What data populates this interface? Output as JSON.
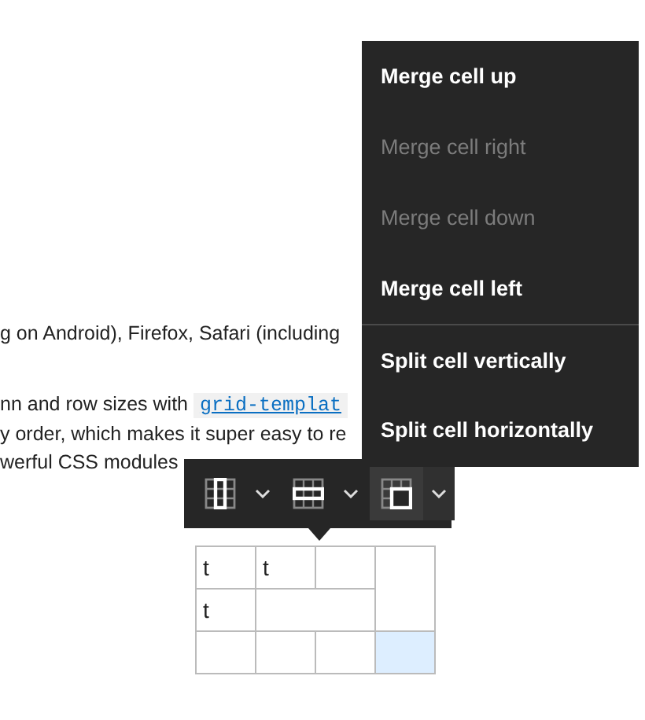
{
  "article": {
    "line_1": "g on Android), Firefox, Safari (including",
    "line_2_text": "nn and row sizes with ",
    "line_2_code": "grid-templat",
    "line_3": "y order, which makes it super easy to re",
    "line_4": "werful CSS modules"
  },
  "toolbar": {
    "buttons": [
      {
        "kind": "column",
        "selected": false
      },
      {
        "kind": "row",
        "selected": false
      },
      {
        "kind": "cell",
        "selected": true
      }
    ]
  },
  "menu": {
    "merge_items": [
      {
        "label": "Merge cell up",
        "disabled": false
      },
      {
        "label": "Merge cell right",
        "disabled": true
      },
      {
        "label": "Merge cell down",
        "disabled": true
      },
      {
        "label": "Merge cell left",
        "disabled": false
      }
    ],
    "split_items": [
      {
        "label": "Split cell vertically",
        "disabled": false
      },
      {
        "label": "Split cell horizontally",
        "disabled": false
      }
    ]
  },
  "table": {
    "rows": [
      [
        {
          "text": "t",
          "selected": false
        },
        {
          "text": "t",
          "selected": false
        },
        {
          "selected": false
        },
        {
          "kind": "tall",
          "selected": false
        }
      ],
      [
        {
          "text": "t",
          "selected": false
        },
        {
          "kind": "wide",
          "selected": false
        }
      ],
      [
        {
          "selected": false
        },
        {
          "selected": false
        },
        {
          "selected": false
        },
        {
          "selected": true
        }
      ]
    ]
  }
}
